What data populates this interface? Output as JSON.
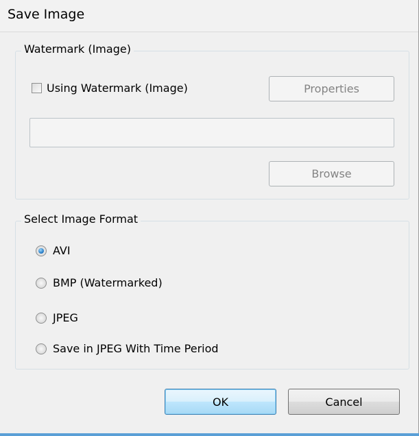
{
  "window": {
    "title": "Save Image"
  },
  "watermark_group": {
    "legend": "Watermark (Image)",
    "checkbox_label": "Using Watermark (Image)",
    "checkbox_checked": false,
    "properties_label": "Properties",
    "path_value": "",
    "browse_label": "Browse"
  },
  "format_group": {
    "legend": "Select Image Format",
    "options": [
      {
        "label": "AVI",
        "checked": true
      },
      {
        "label": "BMP (Watermarked)",
        "checked": false
      },
      {
        "label": "JPEG",
        "checked": false
      },
      {
        "label": "Save in JPEG With Time Period",
        "checked": false
      }
    ]
  },
  "footer": {
    "ok_label": "OK",
    "cancel_label": "Cancel"
  }
}
